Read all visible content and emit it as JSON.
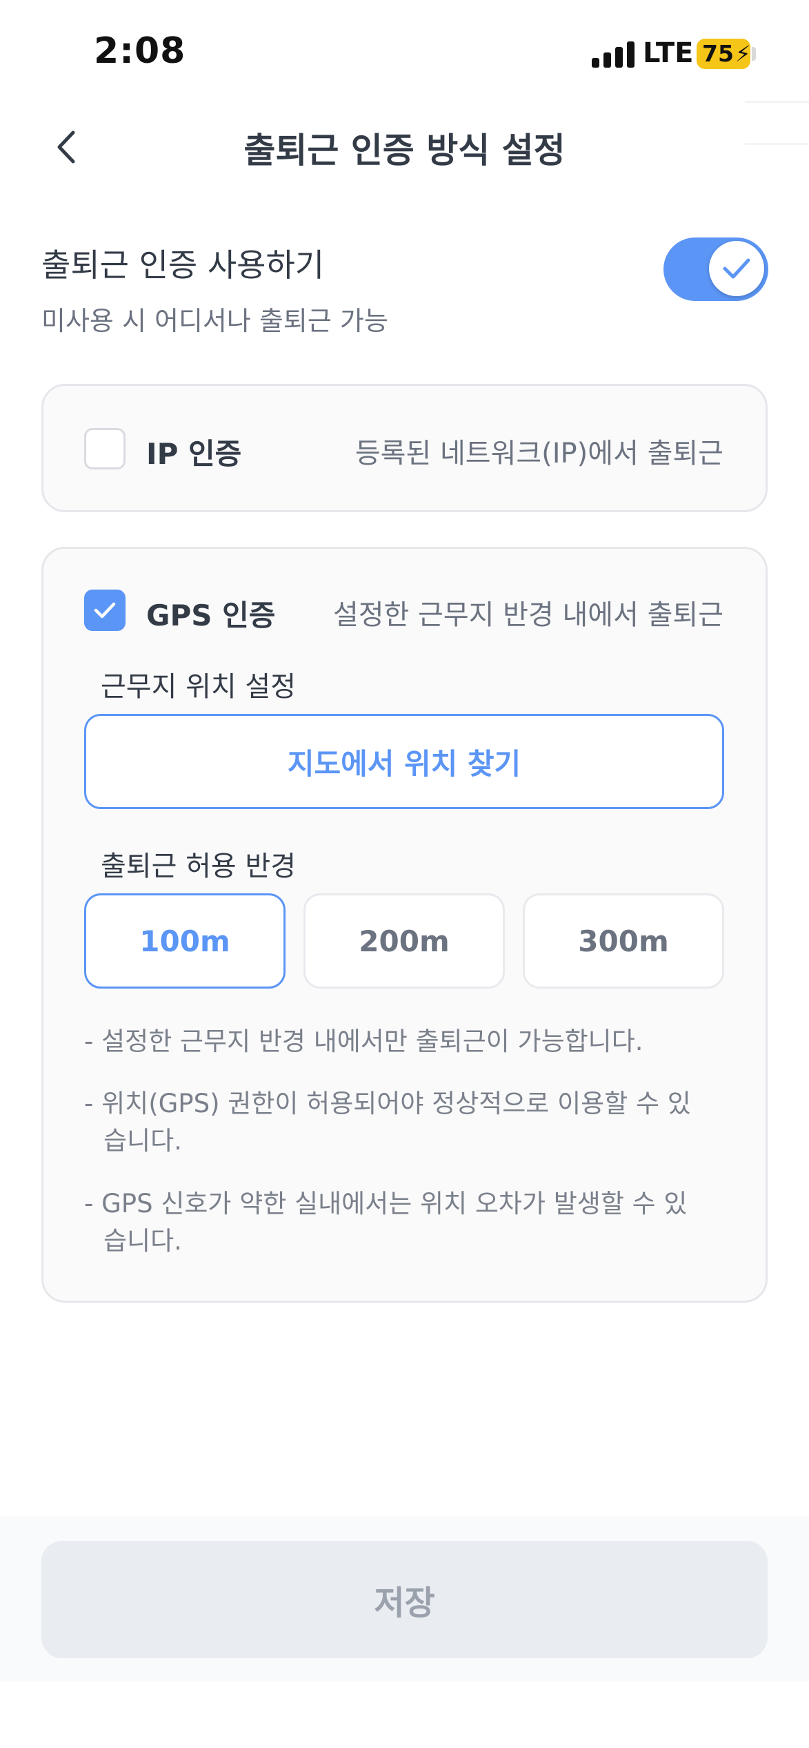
{
  "status_bar": {
    "time": "2:08",
    "network": "LTE",
    "battery": "75"
  },
  "header": {
    "title": "출퇴근 인증 방식 설정"
  },
  "auth_toggle": {
    "title": "출퇴근 인증 사용하기",
    "description": "미사용 시 어디서나 출퇴근 가능",
    "enabled": true
  },
  "ip_option": {
    "label": "IP 인증",
    "description": "등록된 네트워크(IP)에서 출퇴근",
    "checked": false
  },
  "gps_option": {
    "label": "GPS 인증",
    "description": "설정한 근무지 반경 내에서 출퇴근",
    "checked": true,
    "location_label": "근무지 위치 설정",
    "map_button": "지도에서 위치 찾기",
    "radius_label": "출퇴근 허용 반경",
    "radius_options": [
      "100m",
      "200m",
      "300m"
    ],
    "selected_radius": "100m",
    "notes": [
      "- 설정한 근무지 반경 내에서만 출퇴근이 가능합니다.",
      "- 위치(GPS) 권한이 허용되어야 정상적으로 이용할 수 있습니다.",
      "- GPS 신호가 약한 실내에서는 위치 오차가 발생할 수 있습니다."
    ]
  },
  "footer": {
    "save_label": "저장"
  },
  "colors": {
    "accent": "#5b95f5",
    "disabled_button": "#e9ecf1"
  }
}
